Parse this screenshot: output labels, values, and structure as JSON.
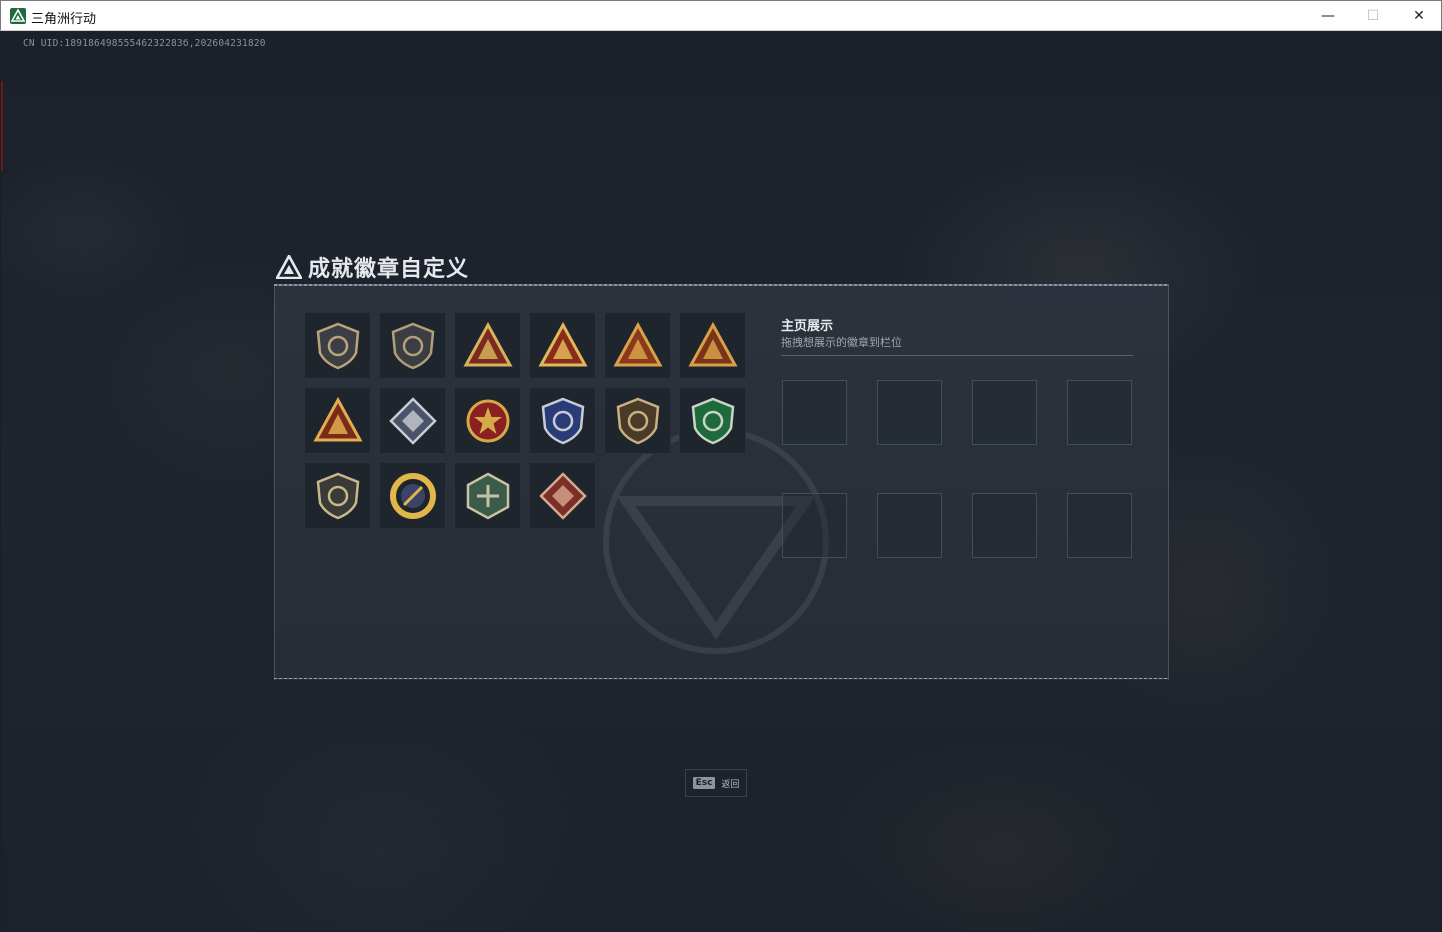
{
  "window": {
    "title": "三角洲行动",
    "min_glyph": "—",
    "max_glyph": "☐",
    "close_glyph": "✕"
  },
  "header": {
    "uid": "CN UID:18918649855546232283б,202604231820"
  },
  "dialog": {
    "title": "成就徽章自定义",
    "badges": [
      {
        "name": "shield-delta-badge",
        "colors": [
          "#3b3f45",
          "#b9a57a"
        ]
      },
      {
        "name": "helicopter-badge",
        "colors": [
          "#3a3d42",
          "#b0a07a"
        ]
      },
      {
        "name": "triangle-s6-badge",
        "colors": [
          "#7a2a1e",
          "#d6b25c"
        ]
      },
      {
        "name": "triangle-number-one-badge",
        "colors": [
          "#8a2a1a",
          "#e0b85a"
        ]
      },
      {
        "name": "triangle-soldier-badge",
        "colors": [
          "#8a3a1a",
          "#d8a24a"
        ]
      },
      {
        "name": "triangle-beast-badge",
        "colors": [
          "#7a3418",
          "#d8a04a"
        ]
      },
      {
        "name": "triangle-stack-badge",
        "colors": [
          "#7a2a18",
          "#e0ae50"
        ]
      },
      {
        "name": "diamond-crystal-badge",
        "colors": [
          "#4a5468",
          "#c8ccd4"
        ]
      },
      {
        "name": "star-medal-badge",
        "colors": [
          "#8a2020",
          "#d6a84a"
        ]
      },
      {
        "name": "police-shield-badge",
        "colors": [
          "#2a3c78",
          "#c8ccd4"
        ]
      },
      {
        "name": "gem-shield-badge",
        "colors": [
          "#4a3a28",
          "#c8b080"
        ]
      },
      {
        "name": "green-crosshair-badge",
        "colors": [
          "#1f6a3a",
          "#c8d4c8"
        ]
      },
      {
        "name": "rifle-shield-badge",
        "colors": [
          "#3a3a38",
          "#c8b88a"
        ]
      },
      {
        "name": "gold-ring-badge",
        "colors": [
          "#3a4468",
          "#e0b84a"
        ]
      },
      {
        "name": "hexagon-dragonfly-badge",
        "colors": [
          "#3a5a4a",
          "#c8c4a0"
        ]
      },
      {
        "name": "dragon-diamond-badge",
        "colors": [
          "#7a3028",
          "#d8a890"
        ]
      }
    ]
  },
  "showcase": {
    "title": "主页展示",
    "subtitle": "拖拽想展示的徽章到栏位",
    "slot_count": 8
  },
  "footer": {
    "esc_key": "Esc",
    "esc_label": "返回"
  },
  "colors": {
    "background": "#1b202a",
    "panel": "#2c333d",
    "accent_green": "#1d6b3d"
  }
}
